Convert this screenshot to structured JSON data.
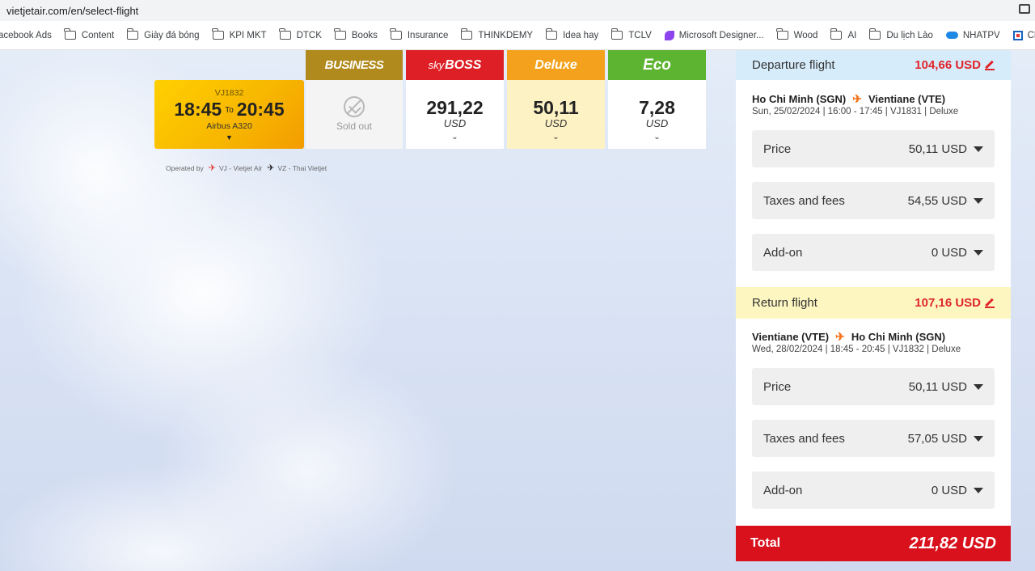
{
  "browser": {
    "url": "vietjetair.com/en/select-flight",
    "bookmarks": [
      "acebook Ads",
      "Content",
      "Giày đá bóng",
      "KPI MKT",
      "DTCK",
      "Books",
      "Insurance",
      "THINKDEMY",
      "Idea hay",
      "TCLV",
      "Microsoft Designer...",
      "Wood",
      "AI",
      "Du lịch Lào",
      "NHATPV",
      "ClickF"
    ]
  },
  "fare_classes": {
    "business": "BUSINESS",
    "skyboss_sky": "sky",
    "skyboss": "BOSS",
    "deluxe": "Deluxe",
    "eco": "Eco"
  },
  "flight": {
    "number": "VJ1832",
    "depart": "18:45",
    "to": "To",
    "arrive": "20:45",
    "aircraft": "Airbus A320",
    "business": "Sold out",
    "skyboss_price": "291,22",
    "deluxe_price": "50,11",
    "eco_price": "7,28",
    "currency": "USD"
  },
  "operated": {
    "label": "Operated by",
    "carrier1": "VJ - Vietjet Air",
    "carrier2": "VZ - Thai Vietjet"
  },
  "summary": {
    "departure": {
      "title": "Departure flight",
      "price": "104,66 USD",
      "from": "Ho Chi Minh (SGN)",
      "to": "Vientiane (VTE)",
      "info": "Sun, 25/02/2024 | 16:00 - 17:45 | VJ1831 | Deluxe",
      "price_label": "Price",
      "price_value": "50,11 USD",
      "tax_label": "Taxes and fees",
      "tax_value": "54,55 USD",
      "addon_label": "Add-on",
      "addon_value": "0 USD"
    },
    "return": {
      "title": "Return flight",
      "price": "107,16 USD",
      "from": "Vientiane (VTE)",
      "to": "Ho Chi Minh (SGN)",
      "info": "Wed, 28/02/2024 | 18:45 - 20:45 | VJ1832 | Deluxe",
      "price_label": "Price",
      "price_value": "50,11 USD",
      "tax_label": "Taxes and fees",
      "tax_value": "57,05 USD",
      "addon_label": "Add-on",
      "addon_value": "0 USD"
    },
    "total_label": "Total",
    "total_value": "211,82 USD"
  },
  "colors": {
    "business": "#b08a1c",
    "skyboss": "#de1f26",
    "deluxe": "#f4a21d",
    "eco": "#5cb431",
    "total": "#d8111d"
  }
}
